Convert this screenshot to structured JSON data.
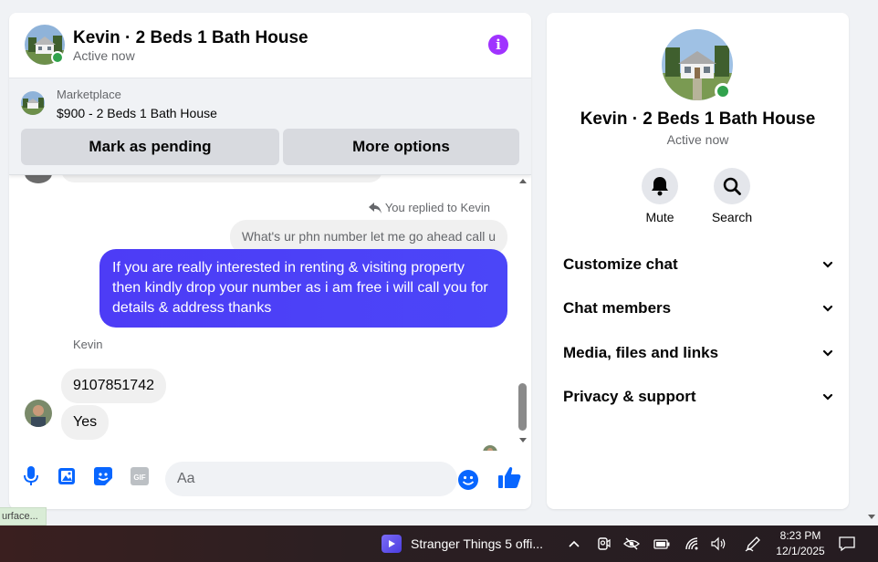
{
  "chat": {
    "header": {
      "title": "Kevin · 2 Beds 1 Bath House",
      "status": "Active now"
    },
    "marketplace": {
      "label": "Marketplace",
      "listing": "$900 - 2 Beds 1 Bath House",
      "mark_pending_label": "Mark as pending",
      "more_options_label": "More options"
    },
    "messages": {
      "replied_label": "You replied to Kevin",
      "quoted_text": "What's ur phn number let me go ahead call u",
      "sent_text": "If you are really interested in renting & visiting property then kindly drop your number as i am free i will call you for details & address thanks",
      "sender_name": "Kevin",
      "received": [
        "9107851742",
        "Yes"
      ]
    },
    "composer": {
      "placeholder": "Aa",
      "gif_label": "GIF"
    }
  },
  "info_panel": {
    "title": "Kevin · 2 Beds 1 Bath House",
    "status": "Active now",
    "actions": [
      {
        "label": "Mute",
        "icon": "bell-icon"
      },
      {
        "label": "Search",
        "icon": "search-icon"
      }
    ],
    "sections": [
      {
        "label": "Customize chat"
      },
      {
        "label": "Chat members"
      },
      {
        "label": "Media, files and links"
      },
      {
        "label": "Privacy & support"
      }
    ]
  },
  "page_tooltip": "urface...",
  "taskbar": {
    "app_label": "Stranger Things 5 offi...",
    "time": "8:23 PM",
    "date": "12/1/2025"
  },
  "colors": {
    "accent": "#0866ff",
    "sent_bubble": "#4a3cf7",
    "info_icon": "#a033ff",
    "online": "#31a24c"
  }
}
